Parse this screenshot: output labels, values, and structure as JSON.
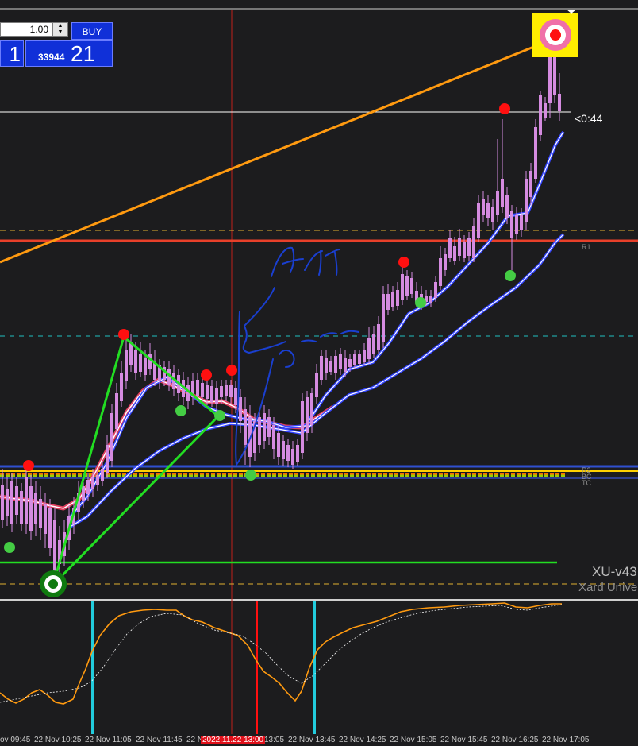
{
  "trade_panel": {
    "lot_size": "1.00",
    "buy_label": "BUY",
    "sell_price_big": "1",
    "buy_price_small": "33944",
    "buy_price_big": "21"
  },
  "countdown": "<0:44",
  "levels": {
    "r1": "R1",
    "r2": "R2",
    "bc": "BC",
    "tc": "TC"
  },
  "watermark": {
    "line1": "XU-v43",
    "line2": "Xard Unive"
  },
  "time_axis": {
    "labels": [
      "ov 09:45",
      "22 Nov 10:25",
      "22 Nov 11:05",
      "22 Nov 11:45",
      "22 N",
      "2022.11.22 13:00",
      "13:05",
      "22 Nov 13:45",
      "22 Nov 14:25",
      "22 Nov 15:05",
      "22 Nov 15:45",
      "22 Nov 16:25",
      "22 Nov 17:05"
    ],
    "highlight_index": 5
  },
  "colors": {
    "background": "#1c1c1e",
    "bull_candle": "#1aa7e8",
    "bear_candle": "#d58be0",
    "trend_line": "#ff9a10",
    "pattern": "#22dd22",
    "pivot_red": "#e8402a",
    "pivot_blue": "#3050d0",
    "signal_red": "#ff1010",
    "signal_green": "#44cc44",
    "osc_main": "#ff9a10",
    "osc_signal": "#ffffff",
    "osc_vline_cyan": "#22ccdd",
    "osc_vline_red": "#ff1010"
  },
  "icons": {
    "target": "bullseye-icon",
    "bottom_marker": "ring-marker-icon"
  }
}
